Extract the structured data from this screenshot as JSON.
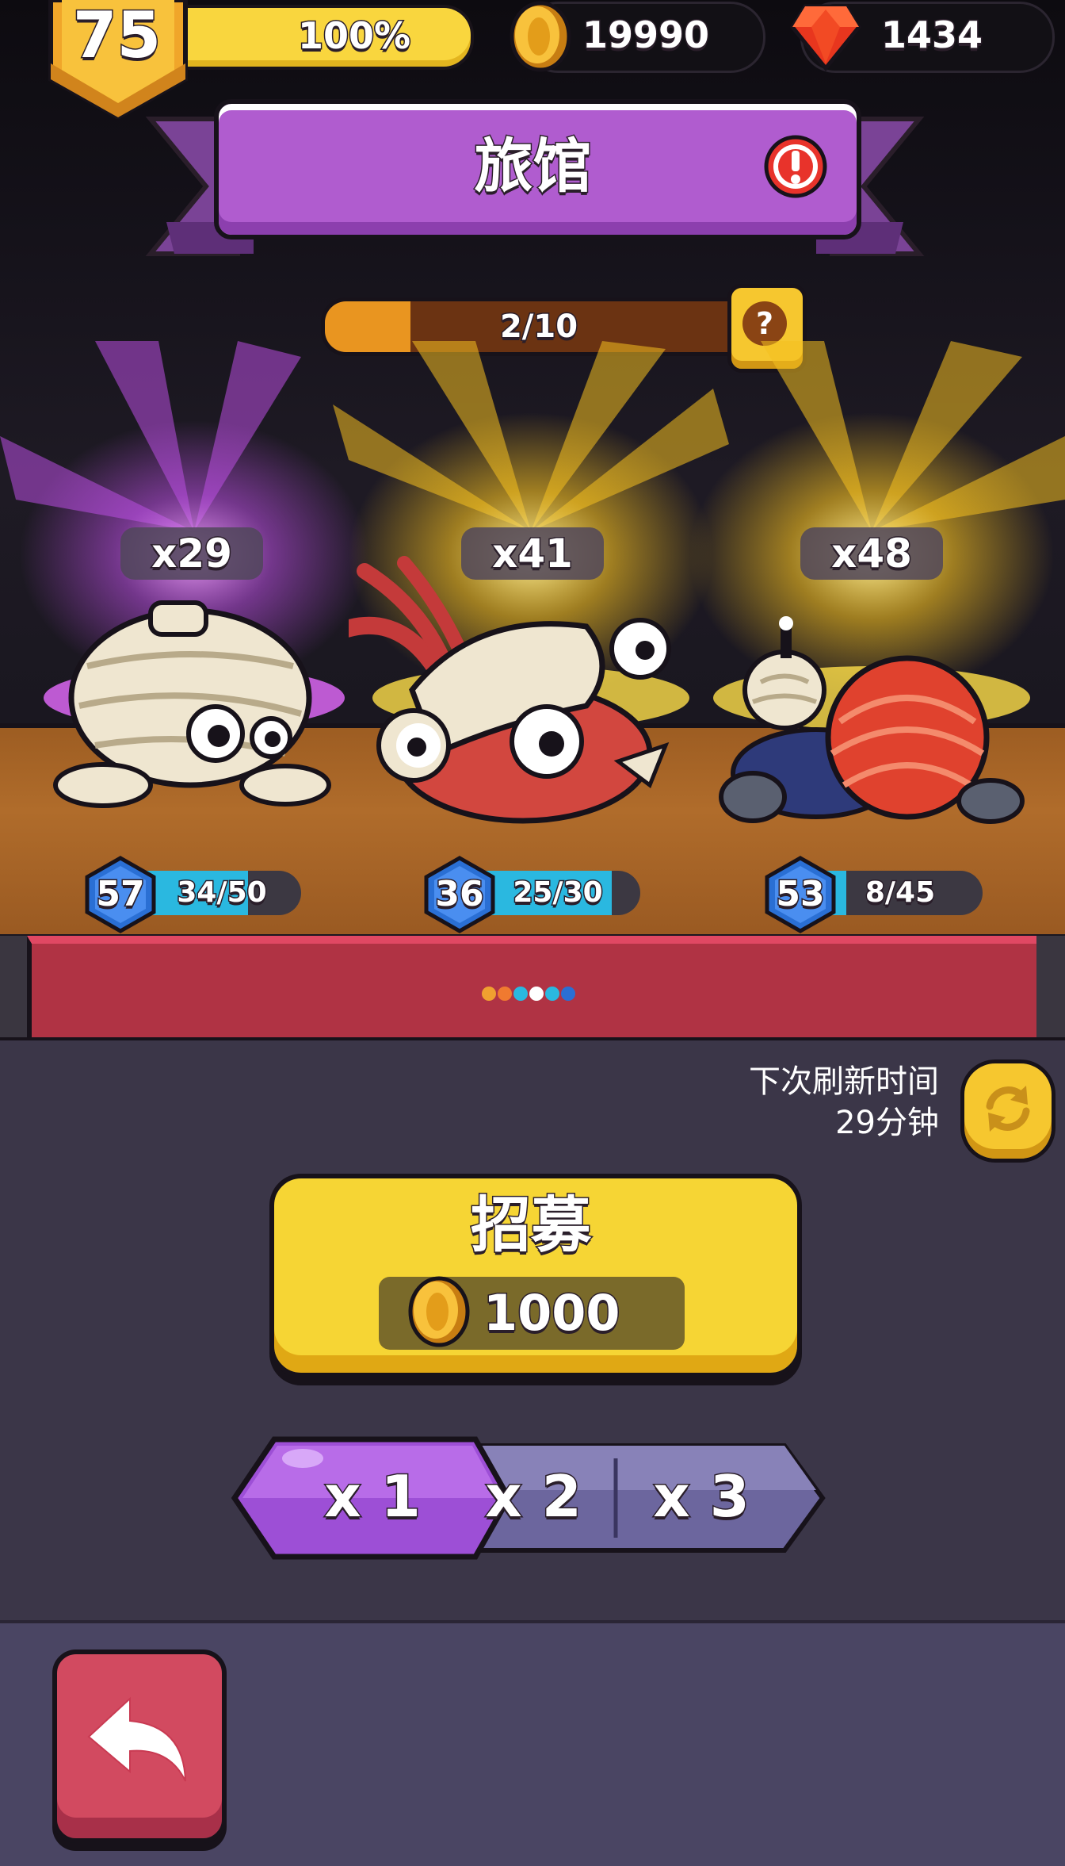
{
  "player": {
    "level": "75",
    "xp_percent_label": "100%",
    "xp_fraction": 1.0
  },
  "currencies": {
    "coins": "19990",
    "gems": "1434",
    "coin_icon": "gold-coin-icon",
    "gem_icon": "red-gem-icon"
  },
  "banner": {
    "title": "旅馆",
    "alert_icon": "exclamation-alert-icon"
  },
  "tavern_progress": {
    "label": "2/10",
    "fraction": 0.2,
    "help_label": "?"
  },
  "heroes": [
    {
      "name_icon": "mummy-hermit-crab-character",
      "count": "x29",
      "level": "57",
      "hp_label": "34/50",
      "hp_fraction": 0.68,
      "glow": "#d35cf0"
    },
    {
      "name_icon": "shrimp-hermit-crab-character",
      "count": "x41",
      "level": "36",
      "hp_label": "25/30",
      "hp_fraction": 0.83,
      "glow": "#ffd23a"
    },
    {
      "name_icon": "bomb-shell-hermit-crab-character",
      "count": "x48",
      "level": "53",
      "hp_label": "8/45",
      "hp_fraction": 0.18,
      "glow": "#ffd23a"
    }
  ],
  "refresh": {
    "line1": "下次刷新时间",
    "line2": "29分钟",
    "icon": "refresh-arrows-icon"
  },
  "recruit": {
    "title": "招募",
    "price": "1000"
  },
  "multipliers": {
    "options": [
      "x 1",
      "x 2",
      "x 3"
    ],
    "selected": "x 1"
  },
  "back_button": {
    "icon": "back-arrow-icon"
  },
  "colors": {
    "accent_purple": "#b05ccf",
    "recruit_yellow": "#f6d534",
    "back_red": "#d24a60",
    "hp_blue": "#2ab8e0"
  }
}
